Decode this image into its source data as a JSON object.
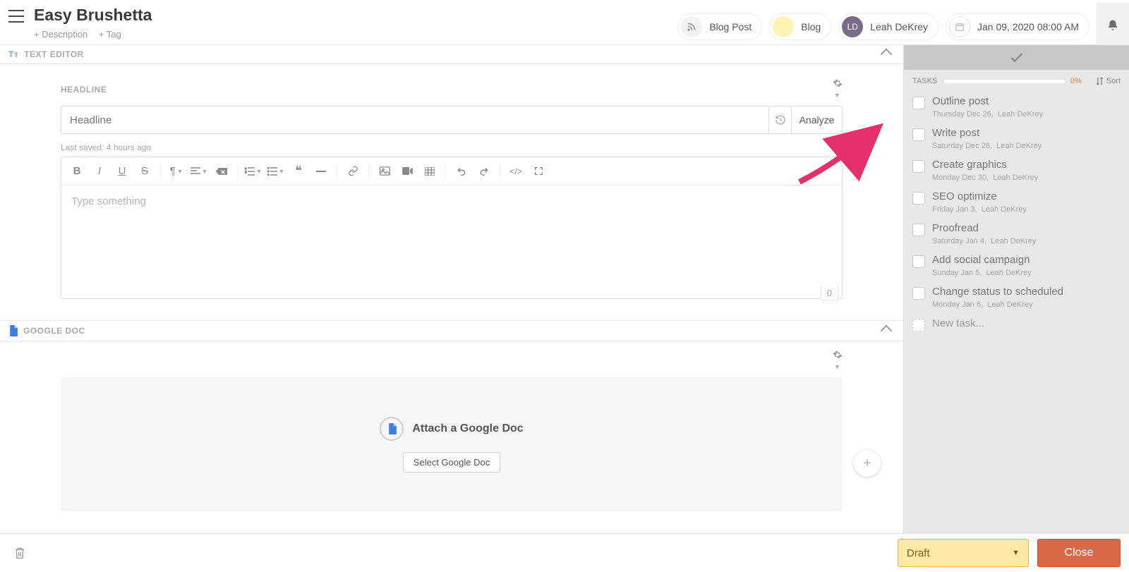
{
  "header": {
    "title": "Easy Brushetta",
    "add_description": "+ Description",
    "add_tag": "+ Tag",
    "pills": {
      "blog_post": "Blog Post",
      "blog": "Blog",
      "user_initials": "LD",
      "user_name": "Leah DeKrey",
      "date": "Jan 09, 2020 08:00 AM"
    }
  },
  "sections": {
    "text_editor": {
      "label": "TEXT EDITOR",
      "headline_label": "HEADLINE",
      "headline_placeholder": "Headline",
      "analyze_label": "Analyze",
      "last_saved": "Last saved: 4 hours ago",
      "editor_placeholder": "Type something",
      "word_count": "0"
    },
    "google_doc": {
      "label": "GOOGLE DOC",
      "attach_label": "Attach a Google Doc",
      "select_label": "Select Google Doc"
    }
  },
  "tasks": {
    "label": "TASKS",
    "percent": "0%",
    "sort": "Sort",
    "items": [
      {
        "title": "Outline post",
        "date": "Thursday Dec 26,",
        "assignee": "Leah DeKrey"
      },
      {
        "title": "Write post",
        "date": "Saturday Dec 28,",
        "assignee": "Leah DeKrey"
      },
      {
        "title": "Create graphics",
        "date": "Monday Dec 30,",
        "assignee": "Leah DeKrey"
      },
      {
        "title": "SEO optimize",
        "date": "Friday Jan 3,",
        "assignee": "Leah DeKrey"
      },
      {
        "title": "Proofread",
        "date": "Saturday Jan 4,",
        "assignee": "Leah DeKrey"
      },
      {
        "title": "Add social campaign",
        "date": "Sunday Jan 5,",
        "assignee": "Leah DeKrey"
      },
      {
        "title": "Change status to scheduled",
        "date": "Monday Jan 6,",
        "assignee": "Leah DeKrey"
      }
    ],
    "new_task": "New task..."
  },
  "footer": {
    "draft": "Draft",
    "close": "Close"
  }
}
